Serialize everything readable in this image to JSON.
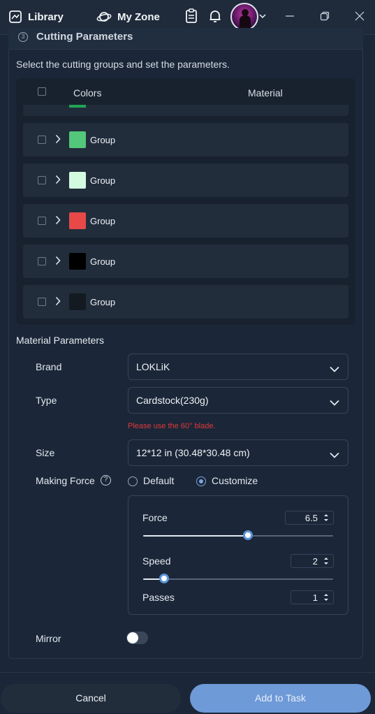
{
  "topbar": {
    "library_label": "Library",
    "myzone_label": "My Zone",
    "icons": [
      "library-icon",
      "planet-icon",
      "clipboard-icon",
      "bell-icon",
      "avatar",
      "chevron-down-icon",
      "minimize-icon",
      "restore-icon",
      "close-icon"
    ]
  },
  "cutting": {
    "title": "Cutting Parameters",
    "step_number": "3",
    "description": "Select the cutting groups and set the parameters.",
    "columns": {
      "colors": "Colors",
      "material": "Material"
    },
    "partial_row_color": "#22a354",
    "groups": [
      {
        "label": "Group",
        "color": "#53c77a"
      },
      {
        "label": "Group",
        "color": "#d3fbe0"
      },
      {
        "label": "Group",
        "color": "#e84848"
      },
      {
        "label": "Group",
        "color": "#000000"
      },
      {
        "label": "Group",
        "color": "#141a22"
      }
    ]
  },
  "material": {
    "section_title": "Material Parameters",
    "brand": {
      "label": "Brand",
      "value": "LOKLiK"
    },
    "type": {
      "label": "Type",
      "value": "Cardstock(230g)"
    },
    "warning": "Please use the 60° blade.",
    "size": {
      "label": "Size",
      "value": "12*12 in (30.48*30.48 cm)"
    },
    "making_force": {
      "label": "Making Force",
      "help": "?",
      "options": [
        "Default",
        "Customize"
      ],
      "selected": "Customize"
    },
    "force": {
      "label": "Force",
      "value": "6.5",
      "level": 0.55
    },
    "speed": {
      "label": "Speed",
      "value": "2",
      "level": 0.11
    },
    "passes": {
      "label": "Passes",
      "value": "1"
    },
    "mirror": {
      "label": "Mirror",
      "enabled": false
    }
  },
  "footer": {
    "cancel_label": "Cancel",
    "add_label": "Add to Task"
  },
  "colors": {
    "background": "#1b2738",
    "accent": "#6f9ad8",
    "warning": "#e0383b"
  }
}
